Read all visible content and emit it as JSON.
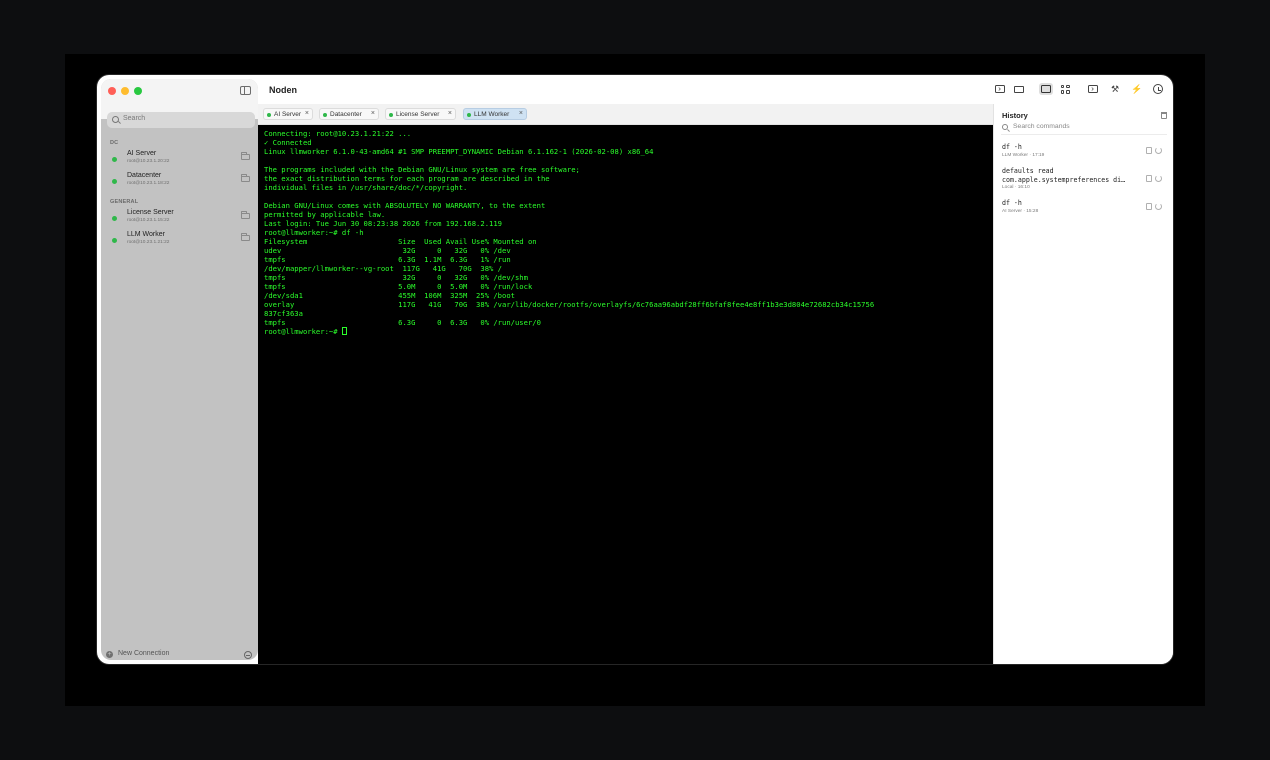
{
  "window": {
    "title": "Noden"
  },
  "sidebar": {
    "search_placeholder": "Search",
    "groups": [
      {
        "label": "DC",
        "hosts": [
          {
            "name": "AI Server",
            "address": "root@10.23.1.20:22",
            "status_color": "#2fb84a"
          },
          {
            "name": "Datacenter",
            "address": "root@10.23.1.18:22",
            "status_color": "#2fb84a"
          }
        ]
      },
      {
        "label": "GENERAL",
        "hosts": [
          {
            "name": "License Server",
            "address": "root@10.23.1.15:22",
            "status_color": "#2fb84a"
          },
          {
            "name": "LLM Worker",
            "address": "root@10.23.1.21:22",
            "status_color": "#2fb84a"
          }
        ]
      }
    ],
    "new_connection_label": "New Connection"
  },
  "toolbar": {
    "buttons": [
      {
        "icon": "terminal-icon",
        "active": false
      },
      {
        "icon": "folder-icon",
        "active": false
      },
      {
        "icon": "single-pane-icon",
        "active": true
      },
      {
        "icon": "grid-icon",
        "active": false
      },
      {
        "icon": "console-icon",
        "active": false
      },
      {
        "icon": "hammer-icon",
        "active": false
      },
      {
        "icon": "magic-wand-icon",
        "active": false
      },
      {
        "icon": "history-icon",
        "active": false
      }
    ]
  },
  "tabs": [
    {
      "label": "AI Server",
      "active": false
    },
    {
      "label": "Datacenter",
      "active": false
    },
    {
      "label": "License Server",
      "active": false
    },
    {
      "label": "LLM Worker",
      "active": true
    }
  ],
  "terminal": {
    "lines": [
      "Connecting: root@10.23.1.21:22 ...",
      "✓ Connected",
      "Linux llmworker 6.1.0-43-amd64 #1 SMP PREEMPT_DYNAMIC Debian 6.1.162-1 (2026-02-08) x86_64",
      "",
      "The programs included with the Debian GNU/Linux system are free software;",
      "the exact distribution terms for each program are described in the",
      "individual files in /usr/share/doc/*/copyright.",
      "",
      "Debian GNU/Linux comes with ABSOLUTELY NO WARRANTY, to the extent",
      "permitted by applicable law.",
      "Last login: Tue Jun 30 08:23:38 2026 from 192.168.2.119",
      "root@llmworker:~# df -h",
      "Filesystem                     Size  Used Avail Use% Mounted on",
      "udev                            32G     0   32G   0% /dev",
      "tmpfs                          6.3G  1.1M  6.3G   1% /run",
      "/dev/mapper/llmworker--vg-root  117G   41G   70G  38% /",
      "tmpfs                           32G     0   32G   0% /dev/shm",
      "tmpfs                          5.0M     0  5.0M   0% /run/lock",
      "/dev/sda1                      455M  106M  325M  25% /boot",
      "overlay                        117G   41G   70G  38% /var/lib/docker/rootfs/overlayfs/6c76aa96abdf28ff6bfaf8fee4e8ff1b3e3d804e72682cb34c15756",
      "837cf363a",
      "tmpfs                          6.3G     0  6.3G   0% /run/user/0"
    ],
    "prompt": "root@llmworker:~# "
  },
  "history": {
    "title": "History",
    "search_placeholder": "Search commands",
    "items": [
      {
        "command": "df -h",
        "host": "LLM Worker",
        "time": "17:19"
      },
      {
        "command": "defaults read\ncom.apple.systempreferences di…",
        "host": "Local",
        "time": "16:10"
      },
      {
        "command": "df -h",
        "host": "AI Server",
        "time": "15:28"
      }
    ]
  }
}
